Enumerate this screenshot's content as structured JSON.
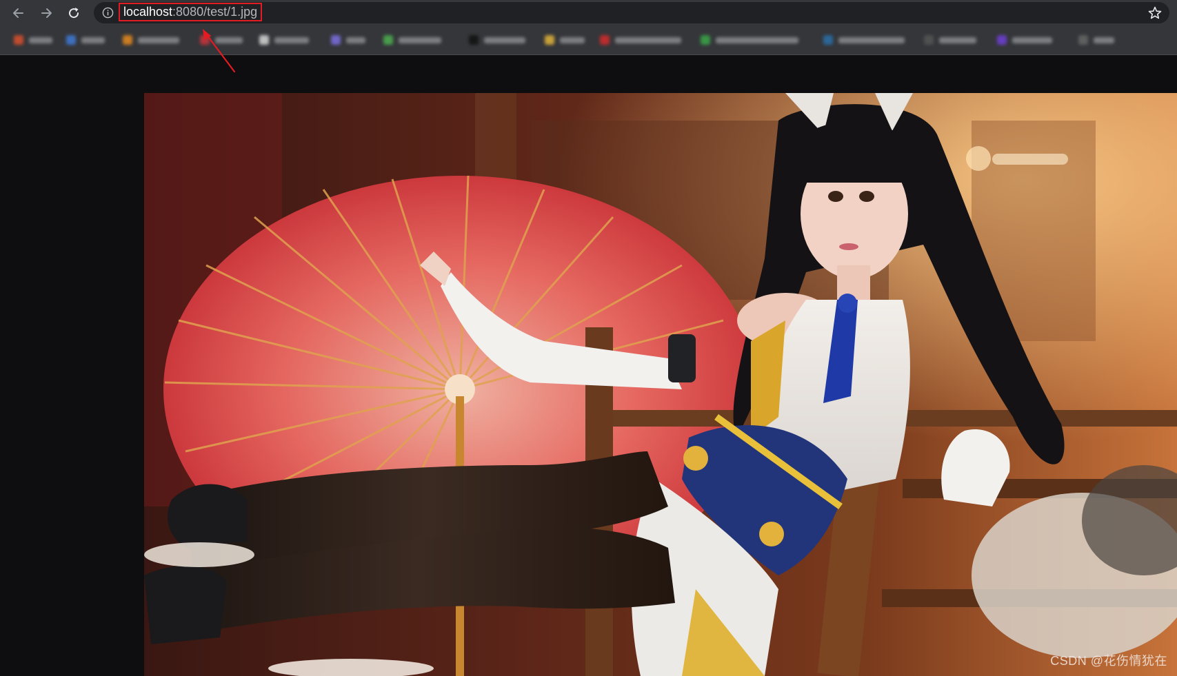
{
  "browser": {
    "url_host": "localhost",
    "url_rest": ":8080/test/1.jpg",
    "icons": {
      "back": "arrow-left-icon",
      "forward": "arrow-right-icon",
      "reload": "reload-icon",
      "info": "info-icon",
      "bookmark": "star-icon"
    }
  },
  "image": {
    "watermark": "CSDN @花伤情犹在"
  },
  "colors": {
    "annotation": "#e31b23",
    "toolbar": "#35363a",
    "page_background": "#0e0e10"
  }
}
